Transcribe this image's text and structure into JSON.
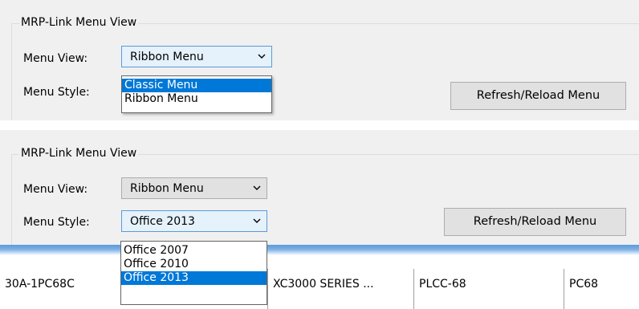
{
  "panel1": {
    "group_title": "MRP-Link Menu View",
    "menu_view_label": "Menu View:",
    "menu_view_value": "Ribbon Menu",
    "menu_style_label": "Menu Style:",
    "refresh_button": "Refresh/Reload Menu",
    "menu_view_options": [
      "Classic Menu",
      "Ribbon Menu"
    ],
    "highlighted_option": "Classic Menu"
  },
  "panel2": {
    "group_title": "MRP-Link Menu View",
    "menu_view_label": "Menu View:",
    "menu_view_value": "Ribbon Menu",
    "menu_style_label": "Menu Style:",
    "menu_style_value": "Office 2013",
    "refresh_button": "Refresh/Reload Menu",
    "menu_style_options": [
      "Office 2007",
      "Office 2010",
      "Office 2013"
    ],
    "highlighted_option": "Office 2013"
  },
  "table_row": {
    "cells": [
      "30A-1PC68C",
      "XC3000 SERIES ...",
      "PLCC-68",
      "PC68"
    ]
  },
  "colors": {
    "panel_background": "#f0f0f0",
    "selection_highlight": "#0078d7",
    "focused_combo_border": "#5b9bd5"
  }
}
